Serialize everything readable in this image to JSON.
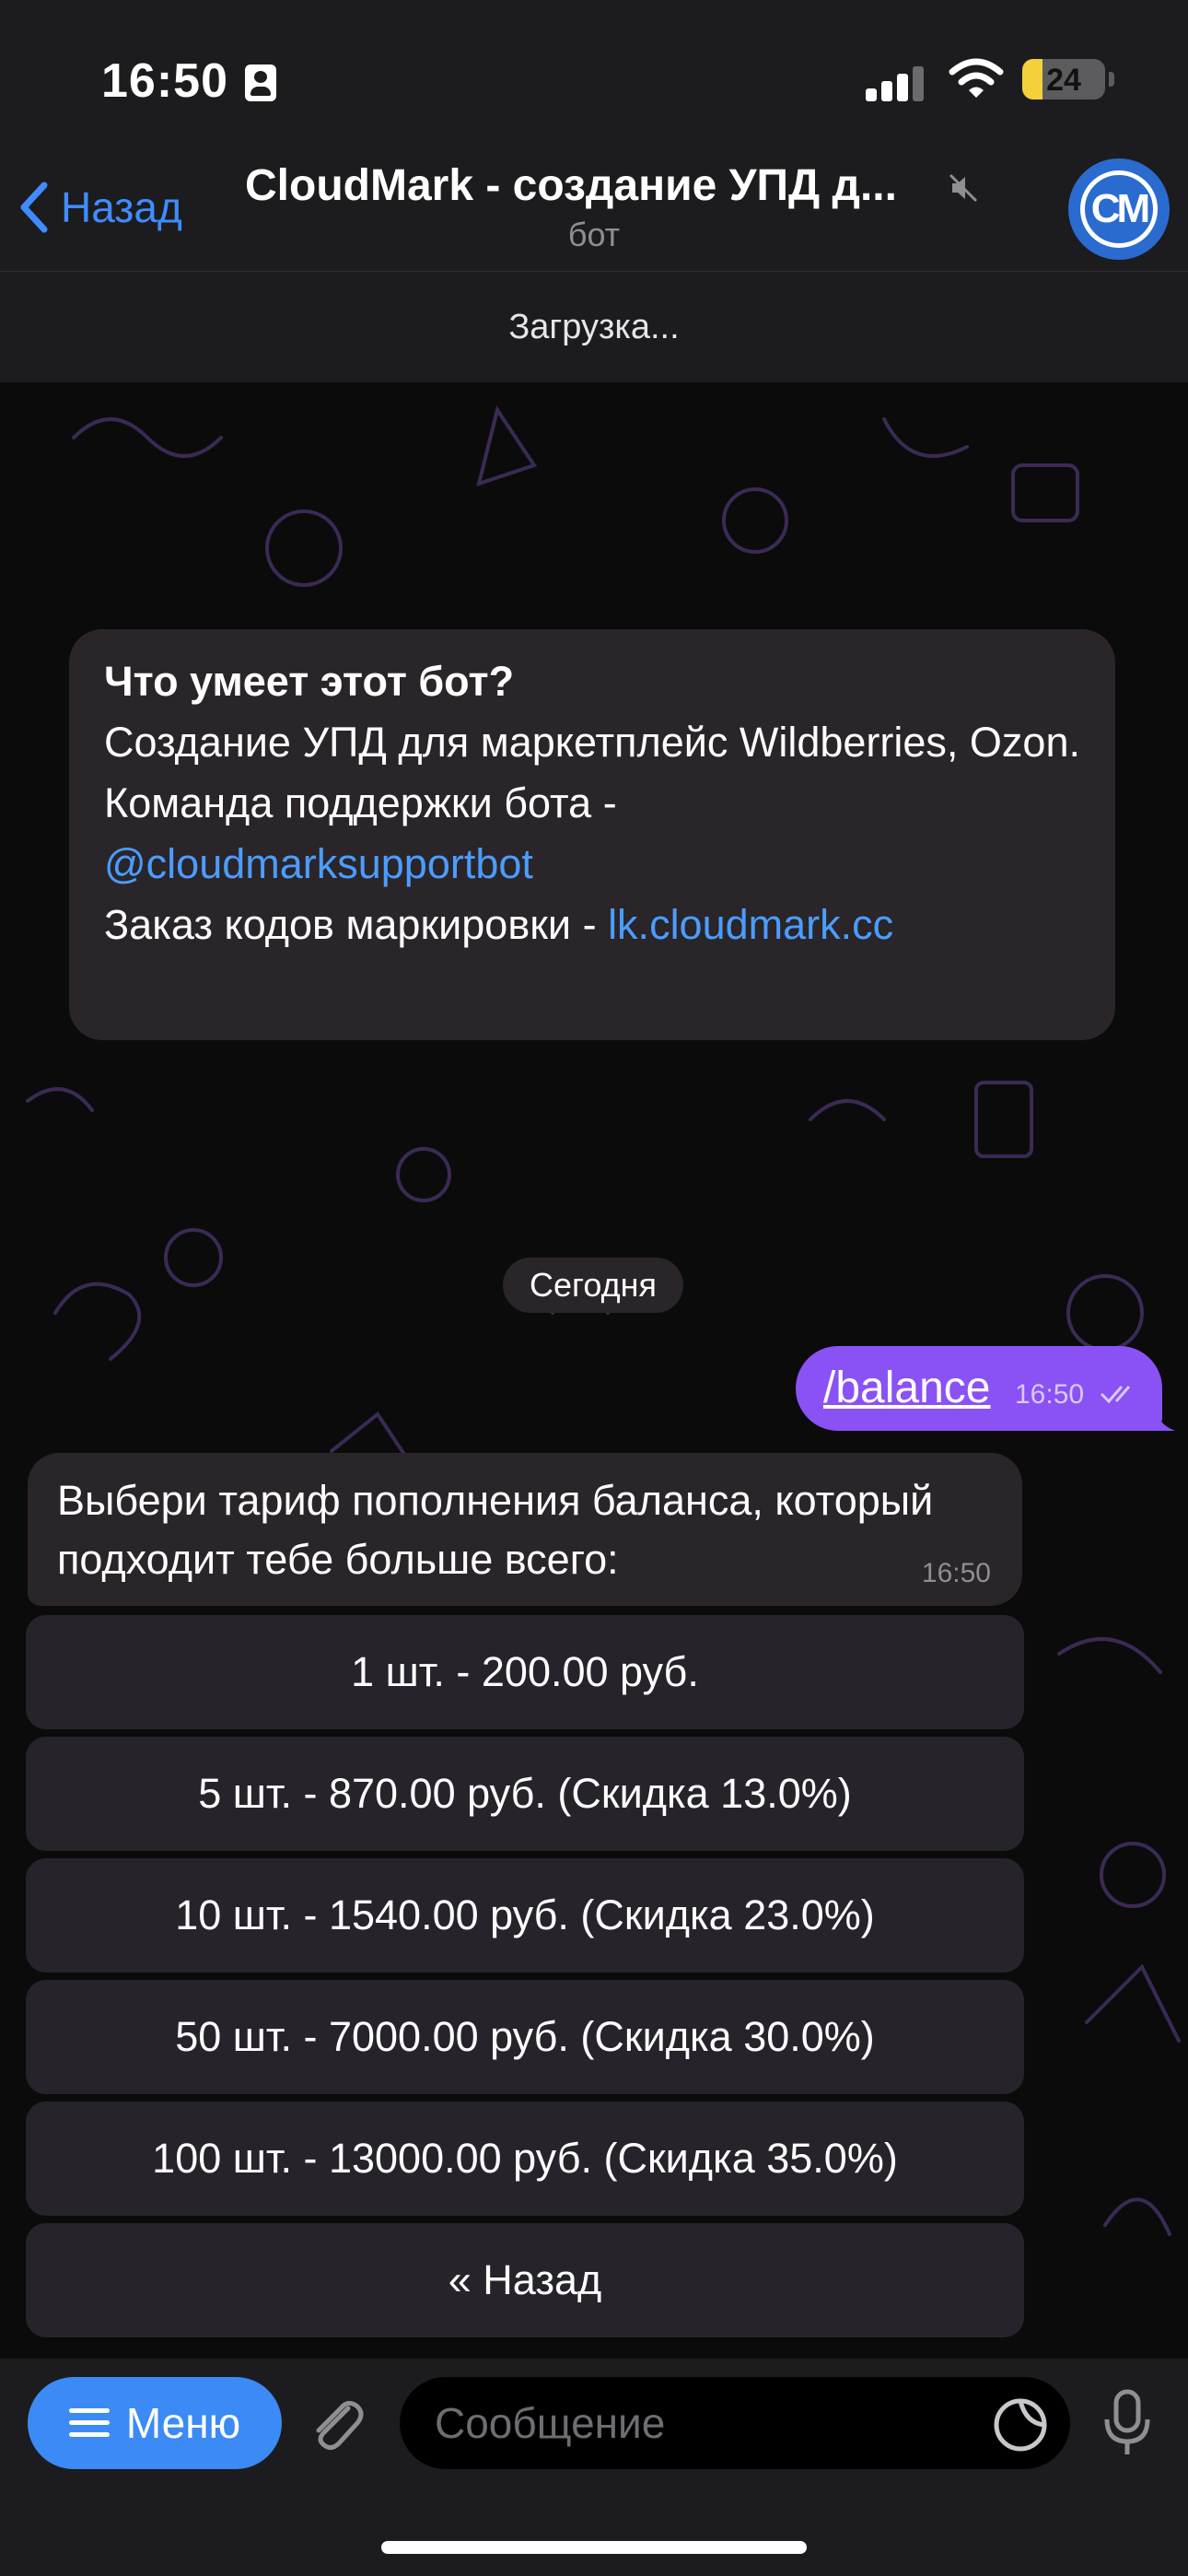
{
  "status_bar": {
    "time": "16:50",
    "battery": "24",
    "battery_level": 0.24
  },
  "header": {
    "back_label": "Назад",
    "title": "CloudMark - создание УПД д...",
    "subtitle": "бот",
    "avatar_text": "CM"
  },
  "loading_text": "Загрузка...",
  "bot_info": {
    "heading": "Что умеет этот бот?",
    "line1": "Создание УПД для маркетплейс Wildberries, Ozon.",
    "line2_prefix": "Команда поддержки бота - ",
    "support_link": "@cloudmarksupportbot",
    "line3_prefix": "Заказ кодов маркировки - ",
    "site_link": "lk.cloudmark.cc"
  },
  "date_separator": "Сегодня",
  "messages": {
    "outgoing": {
      "text": "/balance",
      "time": "16:50"
    },
    "incoming": {
      "text": "Выбери тариф пополнения баланса, который подходит тебе больше всего:",
      "time": "16:50"
    }
  },
  "keyboard": [
    "1 шт. - 200.00 руб.",
    "5 шт. - 870.00 руб. (Скидка 13.0%)",
    "10 шт. - 1540.00 руб. (Скидка 23.0%)",
    "50 шт. - 7000.00 руб. (Скидка 30.0%)",
    "100 шт. - 13000.00 руб. (Скидка 35.0%)",
    "« Назад"
  ],
  "input_bar": {
    "menu_label": "Меню",
    "placeholder": "Сообщение"
  },
  "colors": {
    "accent": "#3b8af5",
    "outgoing_bubble": "#8a52f5",
    "link": "#4a9dff",
    "bubble": "#2a2529"
  }
}
